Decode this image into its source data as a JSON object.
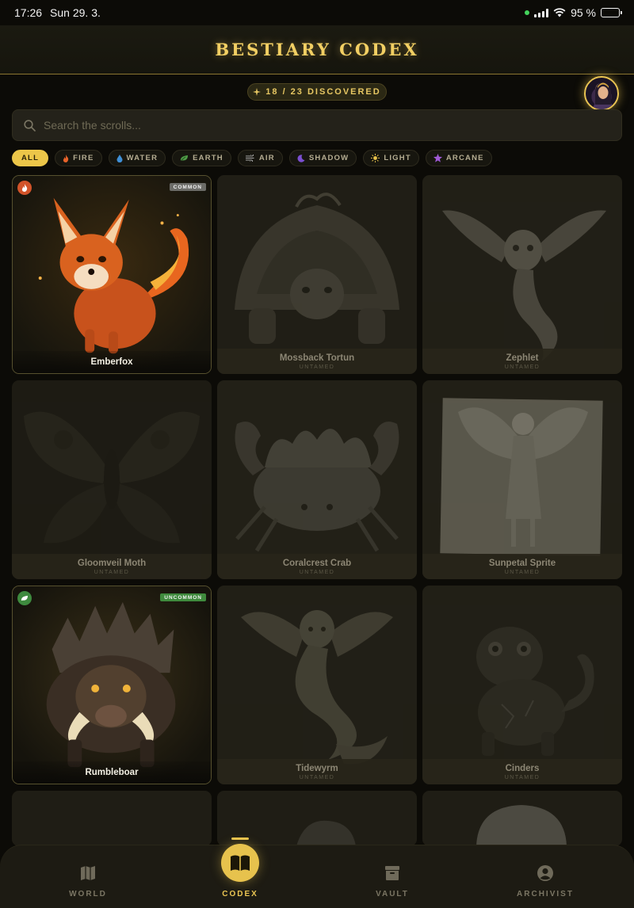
{
  "status": {
    "time": "17:26",
    "date": "Sun 29. 3.",
    "battery": "95 %"
  },
  "header": {
    "title": "BESTIARY CODEX"
  },
  "progress": {
    "label": "18 / 23 DISCOVERED"
  },
  "search": {
    "placeholder": "Search the scrolls..."
  },
  "filters": [
    {
      "label": "ALL",
      "icon": "",
      "color": ""
    },
    {
      "label": "FIRE",
      "icon": "flame-icon",
      "color": "#e8632a"
    },
    {
      "label": "WATER",
      "icon": "droplet-icon",
      "color": "#3f8fd6"
    },
    {
      "label": "EARTH",
      "icon": "leaf-icon",
      "color": "#4e9b46"
    },
    {
      "label": "AIR",
      "icon": "wind-icon",
      "color": "#a9a9a9"
    },
    {
      "label": "SHADOW",
      "icon": "moon-icon",
      "color": "#7b4fd1"
    },
    {
      "label": "LIGHT",
      "icon": "sun-icon",
      "color": "#e8c24a"
    },
    {
      "label": "ARCANE",
      "icon": "star-icon",
      "color": "#a05ad6"
    }
  ],
  "creatures": [
    {
      "name": "Emberfox",
      "status": "",
      "rarity": "COMMON"
    },
    {
      "name": "Mossback Tortun",
      "status": "UNTAMED",
      "rarity": ""
    },
    {
      "name": "Zephlet",
      "status": "UNTAMED",
      "rarity": ""
    },
    {
      "name": "Gloomveil Moth",
      "status": "UNTAMED",
      "rarity": ""
    },
    {
      "name": "Coralcrest Crab",
      "status": "UNTAMED",
      "rarity": ""
    },
    {
      "name": "Sunpetal Sprite",
      "status": "UNTAMED",
      "rarity": ""
    },
    {
      "name": "Rumbleboar",
      "status": "",
      "rarity": "UNCOMMON"
    },
    {
      "name": "Tidewyrm",
      "status": "UNTAMED",
      "rarity": ""
    },
    {
      "name": "Cinders",
      "status": "UNTAMED",
      "rarity": ""
    }
  ],
  "nav": [
    {
      "label": "WORLD",
      "icon": "map-icon"
    },
    {
      "label": "CODEX",
      "icon": "book-icon"
    },
    {
      "label": "VAULT",
      "icon": "archive-box-icon"
    },
    {
      "label": "ARCHIVIST",
      "icon": "user-circle-icon"
    }
  ]
}
